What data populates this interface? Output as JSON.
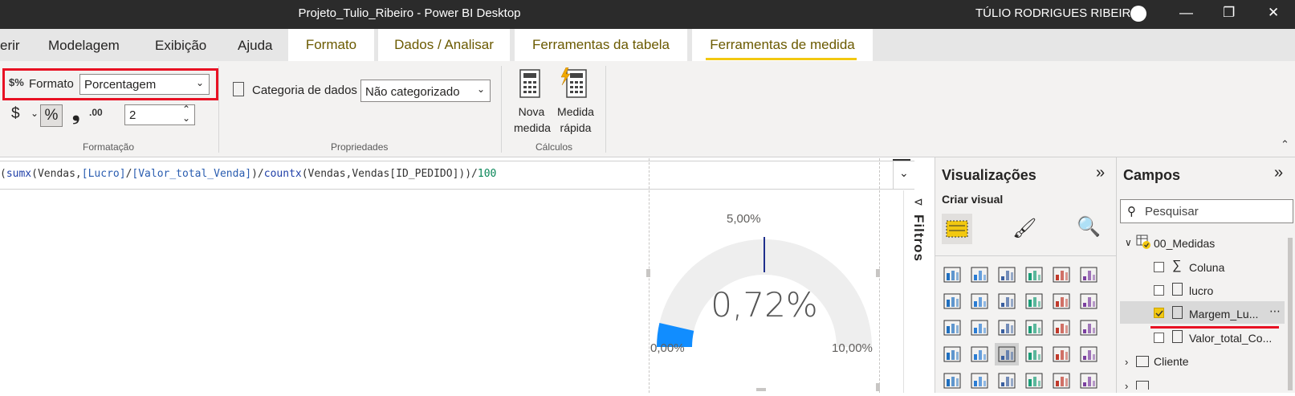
{
  "titlebar": {
    "title": "Projeto_Tulio_Ribeiro - Power BI Desktop",
    "user": "TÚLIO RODRIGUES RIBEIRO",
    "minimize": "—",
    "restore": "❐",
    "close": "✕"
  },
  "menu": {
    "tabs": [
      "erir",
      "Modelagem",
      "Exibição",
      "Ajuda"
    ],
    "context_tabs": [
      "Formato",
      "Dados / Analisar",
      "Ferramentas da tabela",
      "Ferramentas de medida"
    ],
    "active_tab": "Ferramentas de medida"
  },
  "ribbon": {
    "format_label": "Formato",
    "format_value": "Porcentagem",
    "currency_symbol": "$",
    "percent_symbol": "%",
    "comma_symbol": "❟",
    "decimals_symbol": ".00",
    "decimals_value": "2",
    "group_formatting": "Formatação",
    "data_category_label": "Categoria de dados",
    "data_category_value": "Não categorizado",
    "group_properties": "Propriedades",
    "new_measure_line1": "Nova",
    "new_measure_line2": "medida",
    "quick_measure_line1": "Medida",
    "quick_measure_line2": "rápida",
    "group_calculations": "Cálculos"
  },
  "formula": {
    "t1": "(",
    "t2": "sumx",
    "t3": "(Vendas,",
    "t4": "[Lucro]",
    "t5": "/",
    "t6": "[Valor_total_Venda]",
    "t7": ")/",
    "t8": "countx",
    "t9": "(Vendas,Vendas[ID_PEDIDO]))/",
    "t10": "100"
  },
  "gauge": {
    "value_label": "0,72%",
    "min_label": "0,00%",
    "max_label": "10,00%",
    "target_label": "5,00%",
    "value": 0.72,
    "min": 0,
    "max": 10,
    "target": 5,
    "fill_color": "#118dff",
    "track_color": "#eeeeee",
    "target_color": "#1f2f8c"
  },
  "filters": {
    "label": "Filtros"
  },
  "visualizations": {
    "title": "Visualizações",
    "create_visual": "Criar visual"
  },
  "fields": {
    "title": "Campos",
    "search_placeholder": "Pesquisar",
    "table_medidas": "00_Medidas",
    "items": [
      "Coluna",
      "lucro",
      "Margem_Lu...",
      "Valor_total_Co..."
    ],
    "table_cliente": "Cliente",
    "more": "⋯"
  }
}
